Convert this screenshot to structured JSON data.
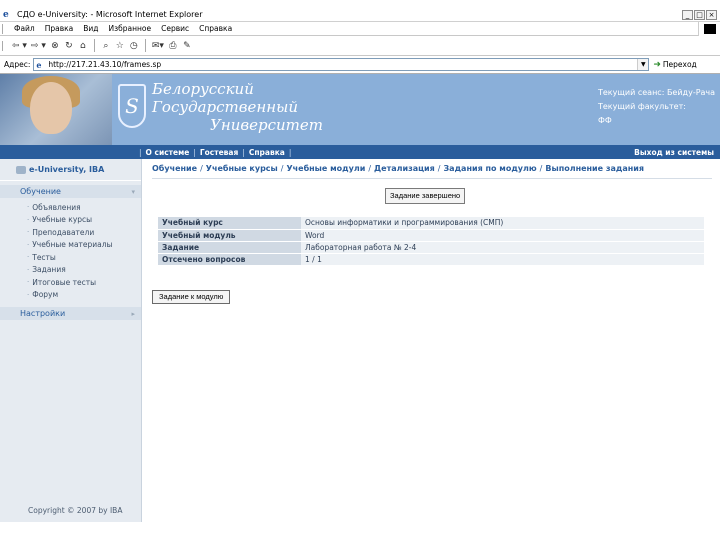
{
  "window": {
    "title": "СДО e-University: - Microsoft Internet Explorer",
    "controls": [
      "_",
      "□",
      "×"
    ]
  },
  "menubar": {
    "items": [
      "Файл",
      "Правка",
      "Вид",
      "Избранное",
      "Сервис",
      "Справка"
    ]
  },
  "toolbar": {
    "icons": [
      "back-icon",
      "forward-icon",
      "stop-icon",
      "refresh-icon",
      "home-icon",
      "search-icon",
      "favorites-icon",
      "history-icon",
      "mail-icon",
      "print-icon",
      "edit-icon"
    ]
  },
  "addressbar": {
    "label": "Адрес:",
    "url": "http://217.21.43.10/frames.sp",
    "go_label": "Переход"
  },
  "header": {
    "university_name": [
      "Белорусский",
      "Государственный",
      "Университет"
    ],
    "session_line": "Текущий сеанс: Бейду-Рача",
    "faculty_label": "Текущий факультет:",
    "faculty_value": "ФФ"
  },
  "navbar": {
    "links": [
      "О системе",
      "Гостевая",
      "Справка"
    ],
    "separator": "|",
    "logout": "Выход из системы"
  },
  "sidebar": {
    "brand": "e-University, IBA",
    "section_main": "Обучение",
    "items": [
      "Объявления",
      "Учебные курсы",
      "Преподаватели",
      "Учебные материалы",
      "Тесты",
      "Задания",
      "Итоговые тесты",
      "Форум"
    ],
    "section_settings": "Настройки",
    "footer": "Copyright © 2007 by IBA"
  },
  "breadcrumb": {
    "items": [
      "Обучение",
      "Учебные курсы",
      "Учебные модули",
      "Детализация",
      "Задания по модулю",
      "Выполнение задания"
    ],
    "separator": "/"
  },
  "main": {
    "finished_button": "Задание завершено",
    "submit_button": "Задание к модулю"
  },
  "info_table": {
    "rows": [
      {
        "label": "Учебный курс",
        "value": "Основы информатики и программирования (СМП)"
      },
      {
        "label": "Учебный модуль",
        "value": "Word"
      },
      {
        "label": "Задание",
        "value": "Лабораторная работа № 2-4"
      },
      {
        "label": "Отсечено вопросов",
        "value": "1 / 1"
      }
    ]
  },
  "colors": {
    "header_bg": "#8aafd9",
    "navbar_bg": "#2a5d9c",
    "sidebar_bg": "#e6ebf1",
    "accent": "#2a5d9c"
  }
}
